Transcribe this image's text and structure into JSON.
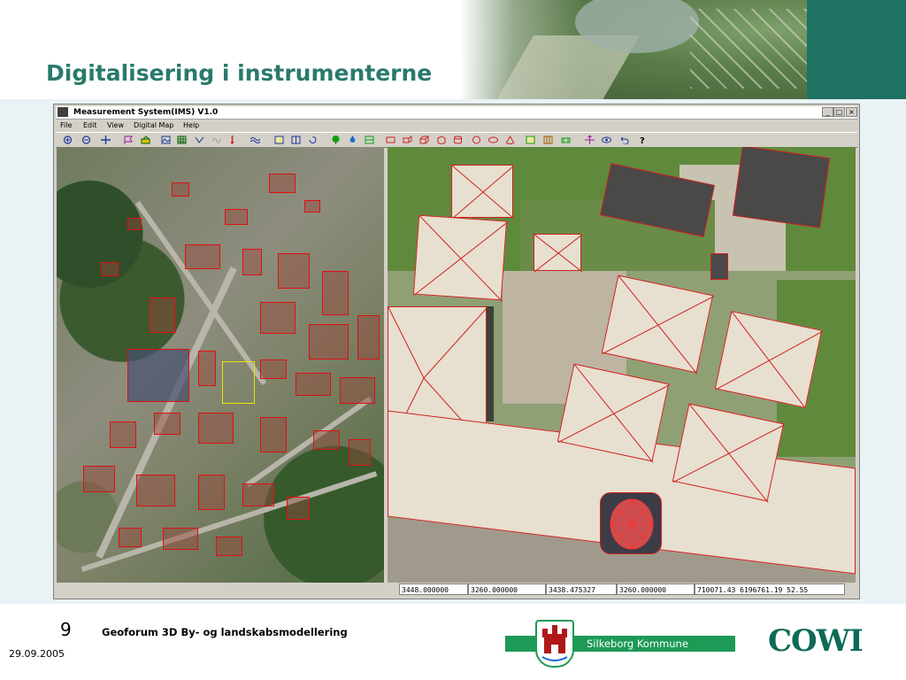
{
  "slide": {
    "title": "Digitalisering i instrumenterne",
    "page_number": "9",
    "footer_title": "Geoforum 3D By- og landskabsmodellering",
    "date": "29.09.2005"
  },
  "window": {
    "title": "Measurement System(IMS) V1.0",
    "controls": {
      "minimize": "_",
      "maximize": "□",
      "close": "×"
    },
    "menu": [
      "File",
      "Edit",
      "View",
      "Digital Map",
      "Help"
    ]
  },
  "toolbar_icons": [
    "zoom-in-icon",
    "zoom-out-icon",
    "pan-icon",
    "flag-icon",
    "layer-icon",
    "image-icon",
    "grid-icon",
    "polyline-icon",
    "curve-icon",
    "marker-icon",
    "wave-icon",
    "frame-icon",
    "split-icon",
    "rotate-icon",
    "tree-icon",
    "drop-icon",
    "overlay-icon",
    "rectangle-icon",
    "box-icon",
    "box3d-icon",
    "cube-icon",
    "cylinder-icon",
    "circle-icon",
    "ellipse-icon",
    "cone-icon",
    "plane-icon",
    "column-icon",
    "wall-icon",
    "move-icon",
    "eye-icon",
    "undo-icon",
    "help-icon"
  ],
  "status_bar": [
    "3448.000000",
    "3260.000000",
    "3438.475327",
    "3260.000000",
    "710071.43  6196761.19  52.55"
  ],
  "logos": {
    "kommune": "Silkeborg Kommune",
    "company": "COWI"
  },
  "colors": {
    "title_teal": "#2a7a6c",
    "header_corner": "#1e7262",
    "kommune_green": "#1d9a55",
    "cowi_green": "#0d6a57",
    "vector_red": "#e01010"
  }
}
